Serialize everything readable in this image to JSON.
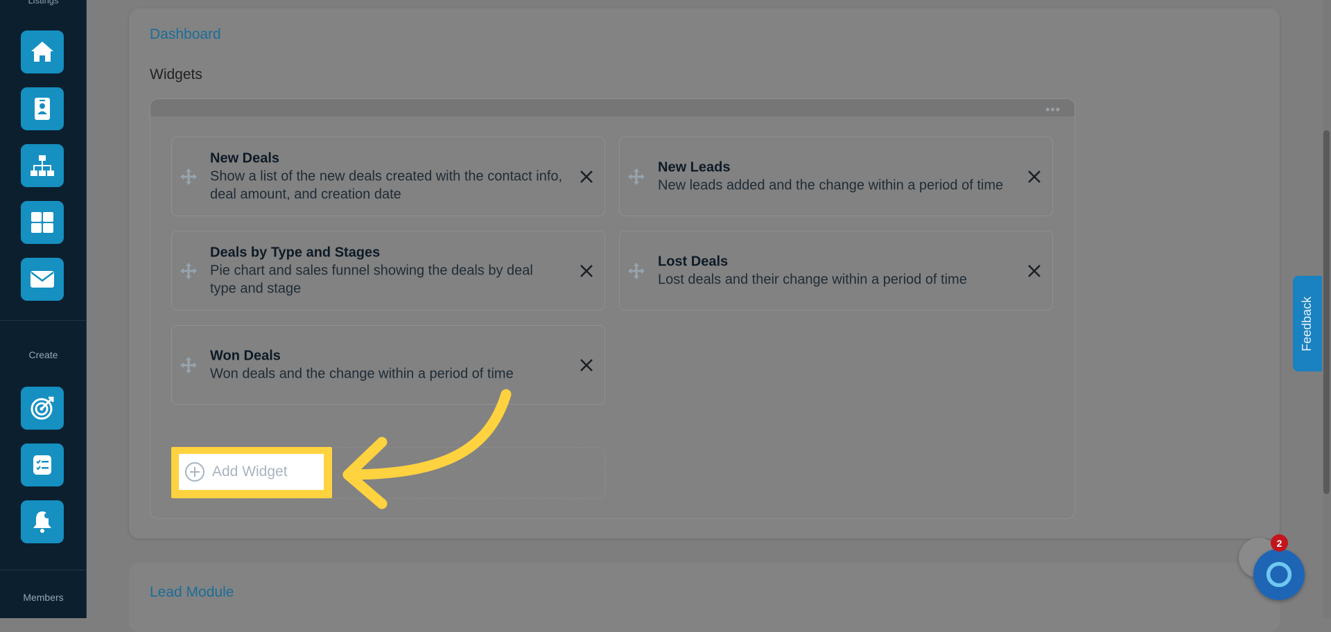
{
  "sidebar": {
    "top_label": "Listings",
    "nav_icons": [
      {
        "name": "home-icon"
      },
      {
        "name": "contacts-icon"
      },
      {
        "name": "org-chart-icon"
      },
      {
        "name": "grid-icon"
      },
      {
        "name": "mail-icon"
      }
    ],
    "create_label": "Create",
    "create_icons": [
      {
        "name": "target-icon"
      },
      {
        "name": "task-list-icon"
      },
      {
        "name": "bell-alert-icon"
      }
    ],
    "members_label": "Members"
  },
  "main": {
    "breadcrumb": "Dashboard",
    "section_title": "Widgets",
    "widgets": [
      {
        "title": "New Deals",
        "description": "Show a list of the new deals created with the contact info, deal amount, and creation date"
      },
      {
        "title": "New Leads",
        "description": "New leads added and the change within a period of time"
      },
      {
        "title": "Deals by Type and Stages",
        "description": "Pie chart and sales funnel showing the deals by deal type and stage"
      },
      {
        "title": "Lost Deals",
        "description": "Lost deals and their change within a period of time"
      },
      {
        "title": "Won Deals",
        "description": "Won deals and the change within a period of time"
      }
    ],
    "add_widget_label": "Add Widget",
    "next_section_title": "Lead Module"
  },
  "feedback_label": "Feedback",
  "chat": {
    "badge_count": "2"
  },
  "colors": {
    "accent": "#1590c1",
    "highlight": "#ffd23f",
    "sidebar_bg": "#0c1f2e"
  }
}
